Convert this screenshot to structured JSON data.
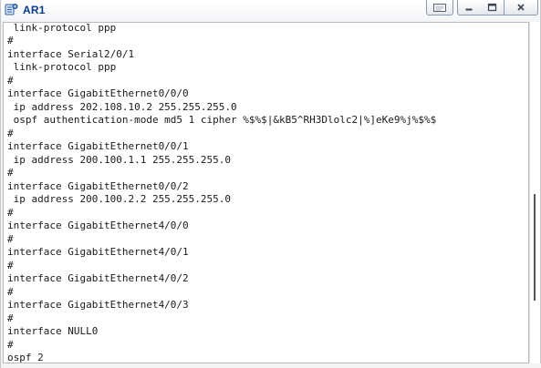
{
  "window": {
    "title": "AR1",
    "icon": "router-app-icon",
    "buttons": {
      "extra": "restore-session-icon",
      "minimize": "minimize-icon",
      "maximize": "maximize-icon",
      "close": "close-icon"
    }
  },
  "terminal": {
    "lines": [
      " link-protocol ppp",
      "#",
      "interface Serial2/0/1",
      " link-protocol ppp",
      "#",
      "interface GigabitEthernet0/0/0",
      " ip address 202.108.10.2 255.255.255.0",
      " ospf authentication-mode md5 1 cipher %$%$|&kB5^RH3Dlolc2|%]eKe9%j%$%$",
      "#",
      "interface GigabitEthernet0/0/1",
      " ip address 200.100.1.1 255.255.255.0",
      "#",
      "interface GigabitEthernet0/0/2",
      " ip address 200.100.2.2 255.255.255.0",
      "#",
      "interface GigabitEthernet4/0/0",
      "#",
      "interface GigabitEthernet4/0/1",
      "#",
      "interface GigabitEthernet4/0/2",
      "#",
      "interface GigabitEthernet4/0/3",
      "#",
      "interface NULL0",
      "#",
      "ospf 2"
    ]
  },
  "scroll": {
    "position_fraction": 0.53,
    "visible_fraction": 0.31
  },
  "colors": {
    "title_text": "#0a3a8a",
    "terminal_bg": "#ffffff",
    "terminal_text": "#1a1a1a"
  }
}
